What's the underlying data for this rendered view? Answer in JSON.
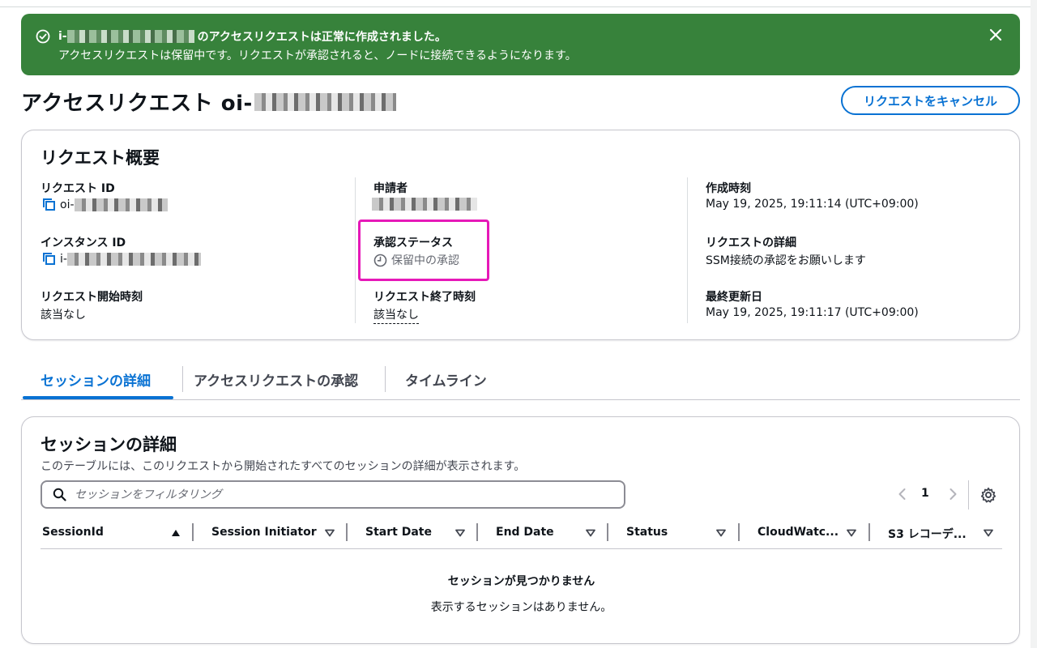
{
  "flash": {
    "type": "success",
    "prefix": "i-",
    "message_suffix": "のアクセスリクエストは正常に作成されました。",
    "detail": "アクセスリクエストは保留中です。リクエストが承認されると、ノードに接続できるようになります。",
    "color": "#37823b"
  },
  "header": {
    "title_prefix": "アクセスリクエスト oi-",
    "cancel_button": "リクエストをキャンセル"
  },
  "summary": {
    "title": "リクエスト概要",
    "request_id": {
      "label": "リクエスト ID",
      "value_prefix": "oi-"
    },
    "instance_id": {
      "label": "インスタンス ID",
      "value_prefix": "i-"
    },
    "start_time": {
      "label": "リクエスト開始時刻",
      "value": "該当なし"
    },
    "requester": {
      "label": "申請者"
    },
    "approval_status": {
      "label": "承認ステータス",
      "value": "保留中の承認"
    },
    "end_time": {
      "label": "リクエスト終了時刻",
      "value": "該当なし"
    },
    "created_at": {
      "label": "作成時刻",
      "value": "May 19, 2025, 19:11:14 (UTC+09:00)"
    },
    "request_details": {
      "label": "リクエストの詳細",
      "value": "SSM接続の承認をお願いします"
    },
    "updated_at": {
      "label": "最終更新日",
      "value": "May 19, 2025, 19:11:17 (UTC+09:00)"
    }
  },
  "tabs": [
    {
      "label": "セッションの詳細",
      "active": true
    },
    {
      "label": "アクセスリクエストの承認",
      "active": false
    },
    {
      "label": "タイムライン",
      "active": false
    }
  ],
  "sessions": {
    "title": "セッションの詳細",
    "description": "このテーブルには、このリクエストから開始されたすべてのセッションの詳細が表示されます。",
    "search_placeholder": "セッションをフィルタリング",
    "page": "1",
    "columns": [
      {
        "label": "SessionId",
        "sort": "ascending"
      },
      {
        "label": "Session Initiator",
        "sort": "none"
      },
      {
        "label": "Start Date",
        "sort": "none"
      },
      {
        "label": "End Date",
        "sort": "none"
      },
      {
        "label": "Status",
        "sort": "none"
      },
      {
        "label": "CloudWatc...",
        "sort": "none"
      },
      {
        "label": "S3 レコーデ...",
        "sort": "none"
      }
    ],
    "empty_title": "セッションが見つかりません",
    "empty_message": "表示するセッションはありません。"
  },
  "colors": {
    "primary": "#0972d3",
    "highlight": "#e619b8",
    "success": "#37823b"
  }
}
